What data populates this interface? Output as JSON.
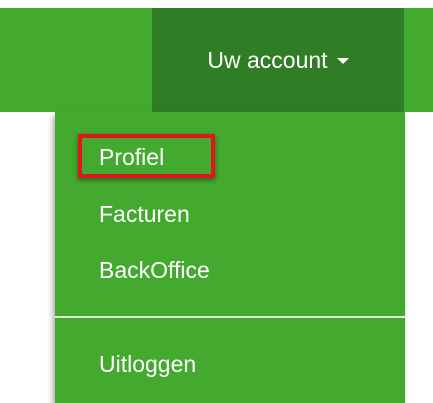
{
  "account_menu": {
    "toggle_label": "Uw account",
    "caret_icon": "caret-down-icon",
    "items": [
      {
        "label": "Profiel",
        "highlighted": true
      },
      {
        "label": "Facturen"
      },
      {
        "label": "BackOffice"
      },
      {
        "label": "Uitloggen"
      }
    ]
  },
  "colors": {
    "navbar": "#44aa2f",
    "toggle_active": "#2f7d24",
    "dropdown": "#44aa2f",
    "highlight": "#e4141b",
    "text": "#ffffff"
  }
}
